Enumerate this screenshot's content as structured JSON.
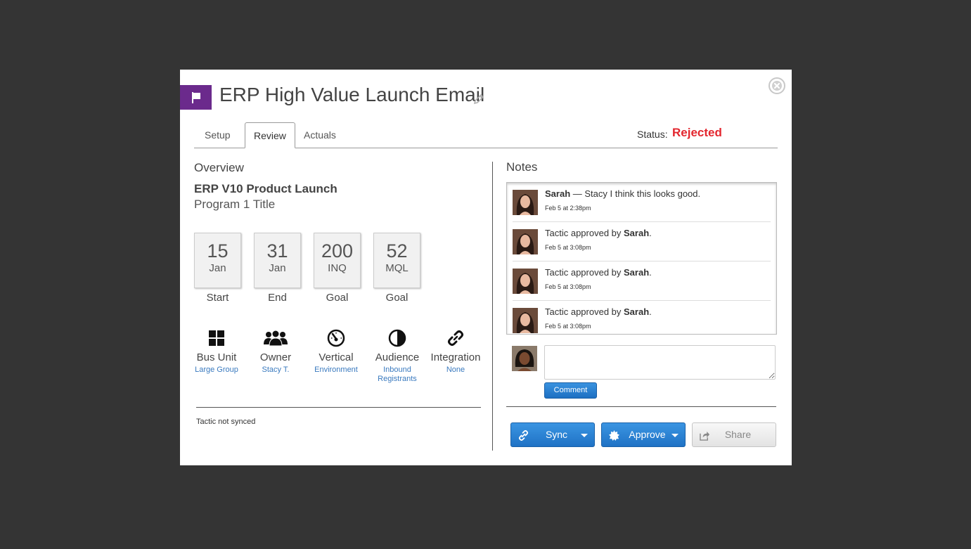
{
  "modal": {
    "title": "ERP High Value Launch Email",
    "tabs": [
      {
        "label": "Setup"
      },
      {
        "label": "Review"
      },
      {
        "label": "Actuals"
      }
    ],
    "active_tab": "Review",
    "status_label": "Status:",
    "status_value": "Rejected",
    "status_color": "#e3262e",
    "brand_color": "#6b2a8c"
  },
  "overview": {
    "heading": "Overview",
    "program_name": "ERP V10 Product Launch",
    "program_title": "Program 1 Title",
    "stats": [
      {
        "num": "15",
        "unit": "Jan",
        "label": "Start"
      },
      {
        "num": "31",
        "unit": "Jan",
        "label": "End"
      },
      {
        "num": "200",
        "unit": "INQ",
        "label": "Goal"
      },
      {
        "num": "52",
        "unit": "MQL",
        "label": "Goal"
      }
    ],
    "attributes": [
      {
        "icon": "grid-icon",
        "label": "Bus Unit",
        "value": "Large Group"
      },
      {
        "icon": "users-icon",
        "label": "Owner",
        "value": "Stacy T."
      },
      {
        "icon": "gauge-icon",
        "label": "Vertical",
        "value": "Environment"
      },
      {
        "icon": "contrast-icon",
        "label": "Audience",
        "value": "Inbound Registrants"
      },
      {
        "icon": "link-icon",
        "label": "Integration",
        "value": "None"
      }
    ],
    "sync_status": "Tactic not synced"
  },
  "notes": {
    "heading": "Notes",
    "items": [
      {
        "author": "Sarah",
        "sep": " — ",
        "text": "Stacy I think this looks good.",
        "time": "Feb 5 at 2:38pm"
      },
      {
        "prefix": "Tactic approved by ",
        "author": "Sarah",
        "suffix": ".",
        "time": "Feb 5 at 3:08pm"
      },
      {
        "prefix": "Tactic approved by ",
        "author": "Sarah",
        "suffix": ".",
        "time": "Feb 5 at 3:08pm"
      },
      {
        "prefix": "Tactic approved by ",
        "author": "Sarah",
        "suffix": ".",
        "time": "Feb 5 at 3:08pm"
      }
    ],
    "comment_placeholder": "",
    "comment_button": "Comment"
  },
  "actions": {
    "sync": "Sync",
    "approve": "Approve",
    "share": "Share"
  }
}
